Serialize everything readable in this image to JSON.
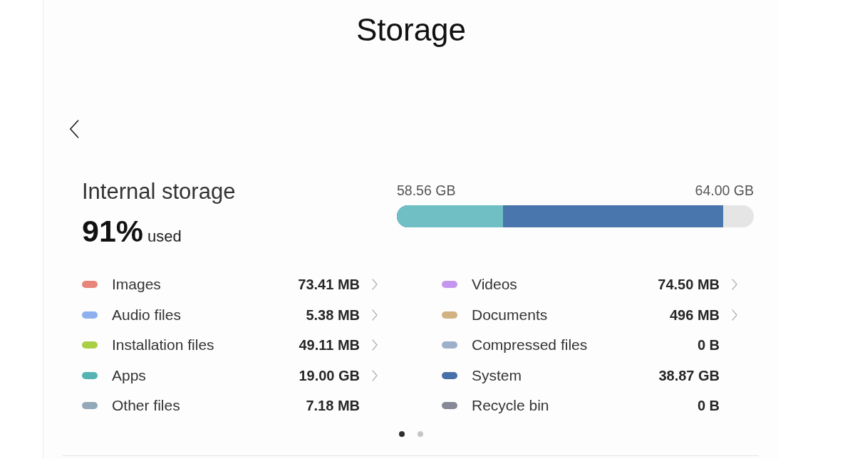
{
  "title": "Storage",
  "storage": {
    "name": "Internal storage",
    "percent": "91%",
    "percent_suffix": "used",
    "used": "58.56 GB",
    "total": "64.00 GB",
    "usage_bar": {
      "segments": [
        {
          "color": "#4a76ae",
          "level": 0.914
        },
        {
          "color": "#70bfc4",
          "level": 0.297
        }
      ]
    }
  },
  "categories": [
    {
      "label": "Images",
      "size": "73.41 MB",
      "color": "#e8857a",
      "has_arrow": true
    },
    {
      "label": "Audio files",
      "size": "5.38 MB",
      "color": "#8db0ee",
      "has_arrow": true
    },
    {
      "label": "Installation files",
      "size": "49.11 MB",
      "color": "#a9cf45",
      "has_arrow": true
    },
    {
      "label": "Apps",
      "size": "19.00 GB",
      "color": "#55b3b3",
      "has_arrow": true
    },
    {
      "label": "Other files",
      "size": "7.18 MB",
      "color": "#93a9b9",
      "has_arrow": false
    },
    {
      "label": "Videos",
      "size": "74.50 MB",
      "color": "#c497ee",
      "has_arrow": true
    },
    {
      "label": "Documents",
      "size": "496 MB",
      "color": "#d2b282",
      "has_arrow": true
    },
    {
      "label": "Compressed files",
      "size": "0 B",
      "color": "#9eb0c9",
      "has_arrow": false
    },
    {
      "label": "System",
      "size": "38.87 GB",
      "color": "#4870a8",
      "has_arrow": false
    },
    {
      "label": "Recycle bin",
      "size": "0 B",
      "color": "#878996",
      "has_arrow": false
    }
  ],
  "pages": [
    {
      "selected": true
    },
    {
      "selected": false
    }
  ]
}
